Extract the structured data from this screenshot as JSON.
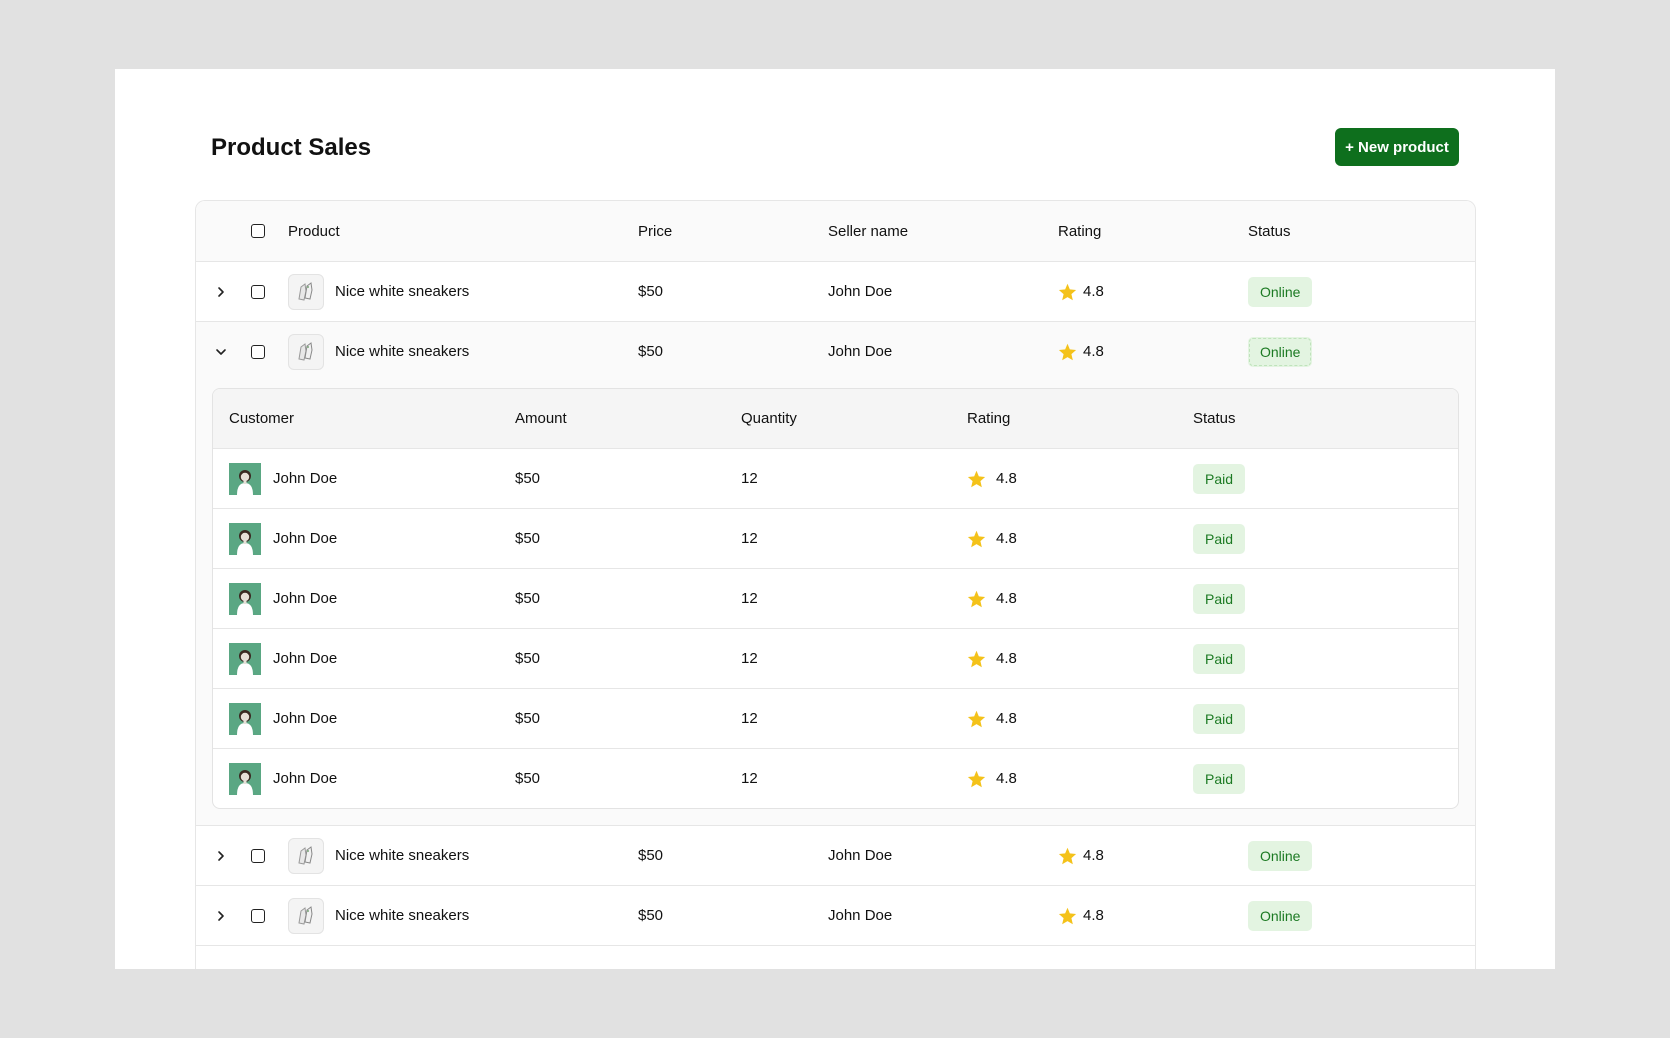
{
  "page": {
    "title": "Product Sales"
  },
  "toolbar": {
    "new_product_label": "+ New product"
  },
  "columns": {
    "product": "Product",
    "price": "Price",
    "seller": "Seller name",
    "rating": "Rating",
    "status": "Status"
  },
  "products": [
    {
      "name": "Nice white sneakers",
      "price": "$50",
      "seller": "John Doe",
      "rating": "4.8",
      "status": "Online",
      "expanded": false
    },
    {
      "name": "Nice white sneakers",
      "price": "$50",
      "seller": "John Doe",
      "rating": "4.8",
      "status": "Online",
      "expanded": true
    },
    {
      "name": "Nice white sneakers",
      "price": "$50",
      "seller": "John Doe",
      "rating": "4.8",
      "status": "Online",
      "expanded": false
    },
    {
      "name": "Nice white sneakers",
      "price": "$50",
      "seller": "John Doe",
      "rating": "4.8",
      "status": "Online",
      "expanded": false
    }
  ],
  "subtable": {
    "columns": {
      "customer": "Customer",
      "amount": "Amount",
      "quantity": "Quantity",
      "rating": "Rating",
      "status": "Status"
    },
    "rows": [
      {
        "customer": "John Doe",
        "amount": "$50",
        "quantity": "12",
        "rating": "4.8",
        "status": "Paid"
      },
      {
        "customer": "John Doe",
        "amount": "$50",
        "quantity": "12",
        "rating": "4.8",
        "status": "Paid"
      },
      {
        "customer": "John Doe",
        "amount": "$50",
        "quantity": "12",
        "rating": "4.8",
        "status": "Paid"
      },
      {
        "customer": "John Doe",
        "amount": "$50",
        "quantity": "12",
        "rating": "4.8",
        "status": "Paid"
      },
      {
        "customer": "John Doe",
        "amount": "$50",
        "quantity": "12",
        "rating": "4.8",
        "status": "Paid"
      },
      {
        "customer": "John Doe",
        "amount": "$50",
        "quantity": "12",
        "rating": "4.8",
        "status": "Paid"
      }
    ]
  },
  "icons": {
    "expand": "chevron-right-icon",
    "collapse": "chevron-down-icon",
    "rating": "star-icon"
  },
  "colors": {
    "accent": "#0e6f1d",
    "badge_bg": "#e3f4e1",
    "badge_text": "#1c7a23",
    "star": "#f4c21a",
    "avatar_bg": "#5aa783"
  }
}
